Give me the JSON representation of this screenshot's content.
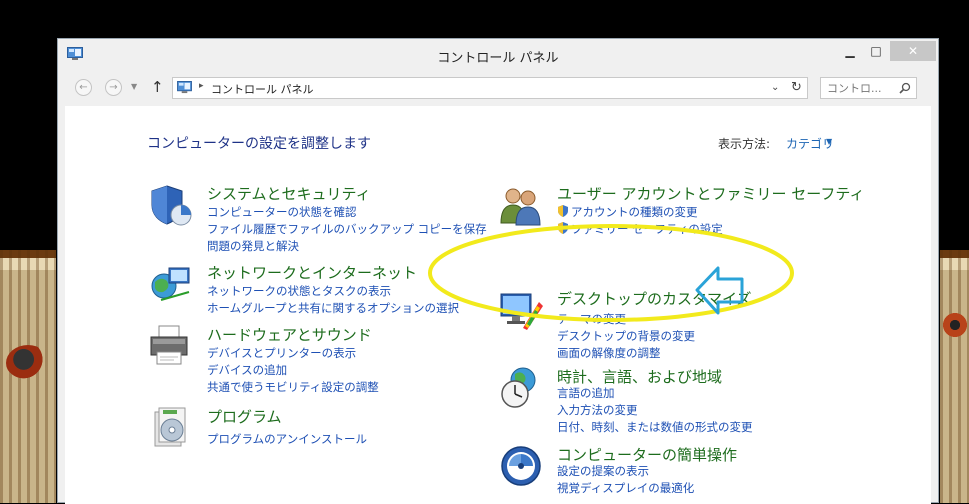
{
  "window": {
    "title": "コントロール パネル",
    "minimize_glyph": "▁",
    "maximize_glyph": "□",
    "close_glyph": "✕"
  },
  "navigation": {
    "back_glyph": "←",
    "forward_glyph": "→",
    "up_glyph": "↑",
    "address_separator": "▸",
    "address_path": "コントロール パネル",
    "address_dropdown_glyph": "⌄",
    "refresh_glyph": "↻",
    "search_placeholder": "コントロ..."
  },
  "content": {
    "page_title": "コンピューターの設定を調整します",
    "view_by_label": "表示方法:",
    "view_by_value": "カテゴリ",
    "view_by_caret": "▼"
  },
  "categories": [
    {
      "title": "システムとセキュリティ",
      "icon": "system-security-shield-icon",
      "links": [
        "コンピューターの状態を確認",
        "ファイル履歴でファイルのバックアップ コピーを保存",
        "問題の発見と解決"
      ]
    },
    {
      "title": "ネットワークとインターネット",
      "icon": "network-globe-icon",
      "links": [
        "ネットワークの状態とタスクの表示",
        "ホームグループと共有に関するオプションの選択"
      ]
    },
    {
      "title": "ハードウェアとサウンド",
      "icon": "printer-icon",
      "links": [
        "デバイスとプリンターの表示",
        "デバイスの追加",
        "共通で使うモビリティ設定の調整"
      ]
    },
    {
      "title": "プログラム",
      "icon": "programs-disc-icon",
      "links": [
        "プログラムのアンインストール"
      ]
    },
    {
      "title": "ユーザー アカウントとファミリー セーフティ",
      "icon": "users-icon",
      "links": [
        "アカウントの種類の変更",
        "ファミリー セーフティの設定"
      ]
    },
    {
      "title": "デスクトップのカスタマイズ",
      "icon": "desktop-monitor-palette-icon",
      "links": [
        "テーマの変更",
        "デスクトップの背景の変更",
        "画面の解像度の調整"
      ]
    },
    {
      "title": "時計、言語、および地域",
      "icon": "clock-globe-icon",
      "links": [
        "言語の追加",
        "入力方法の変更",
        "日付、時刻、または数値の形式の変更"
      ]
    },
    {
      "title": "コンピューターの簡単操作",
      "icon": "ease-of-access-icon",
      "links": [
        "設定の提案の表示",
        "視覚ディスプレイの最適化"
      ]
    }
  ],
  "colors": {
    "category_title": "#1d6c1d",
    "link": "#1e50b4",
    "highlight_ellipse": "#f2ea1c",
    "arrow": "#2aa3d8"
  }
}
